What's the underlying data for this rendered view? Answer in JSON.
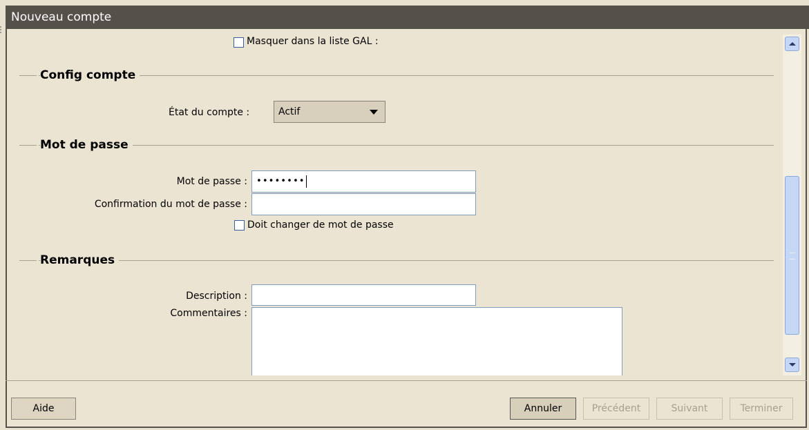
{
  "window": {
    "title": "Nouveau compte"
  },
  "top": {
    "hide_gal_label": "Masquer dans la liste GAL :"
  },
  "sections": {
    "config": {
      "title": "Config compte"
    },
    "password": {
      "title": "Mot de passe"
    },
    "notes": {
      "title": "Remarques"
    }
  },
  "account": {
    "state_label": "État du compte :",
    "state_value": "Actif"
  },
  "password": {
    "label": "Mot de passe :",
    "value": "••••••••",
    "confirm_label": "Confirmation du mot de passe :",
    "confirm_value": "",
    "must_change_label": "Doit changer de mot de passe"
  },
  "notes": {
    "description_label": "Description :",
    "description_value": "",
    "comments_label": "Commentaires :",
    "comments_value": ""
  },
  "buttons": {
    "help": "Aide",
    "cancel": "Annuler",
    "previous": "Précédent",
    "next": "Suivant",
    "finish": "Terminer"
  }
}
